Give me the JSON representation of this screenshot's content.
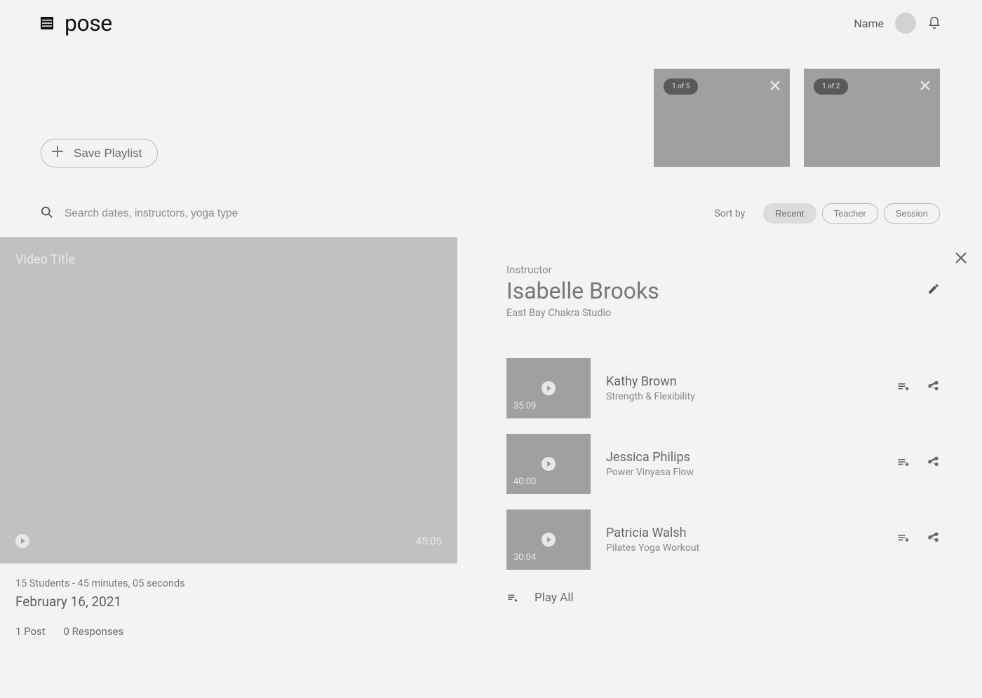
{
  "header": {
    "logo": "pose",
    "user_name": "Name"
  },
  "thumb_strip": [
    {
      "badge": "1 of 5"
    },
    {
      "badge": "1 of 2"
    }
  ],
  "save_playlist_label": "Save Playlist",
  "search": {
    "placeholder": "Search dates, instructors, yoga type"
  },
  "sort": {
    "label": "Sort by",
    "options": [
      "Recent",
      "Teacher",
      "Session"
    ],
    "active": "Recent"
  },
  "video": {
    "title_overlay": "Video Title",
    "duration": "45:05",
    "meta_sub": "15 Students - 45 minutes, 05 seconds",
    "date": "February 16, 2021",
    "posts": "1 Post",
    "responses": "0 Responses"
  },
  "panel": {
    "label": "Instructor",
    "title": "Isabelle Brooks",
    "sub": "East Bay Chakra Studio",
    "play_all": "Play All",
    "items": [
      {
        "time": "35:09",
        "title": "Kathy Brown",
        "sub": "Strength & Flexibility"
      },
      {
        "time": "40:00",
        "title": "Jessica Philips",
        "sub": "Power Vinyasa Flow"
      },
      {
        "time": "30:04",
        "title": "Patricia Walsh",
        "sub": "Pilates Yoga Workout"
      }
    ]
  }
}
